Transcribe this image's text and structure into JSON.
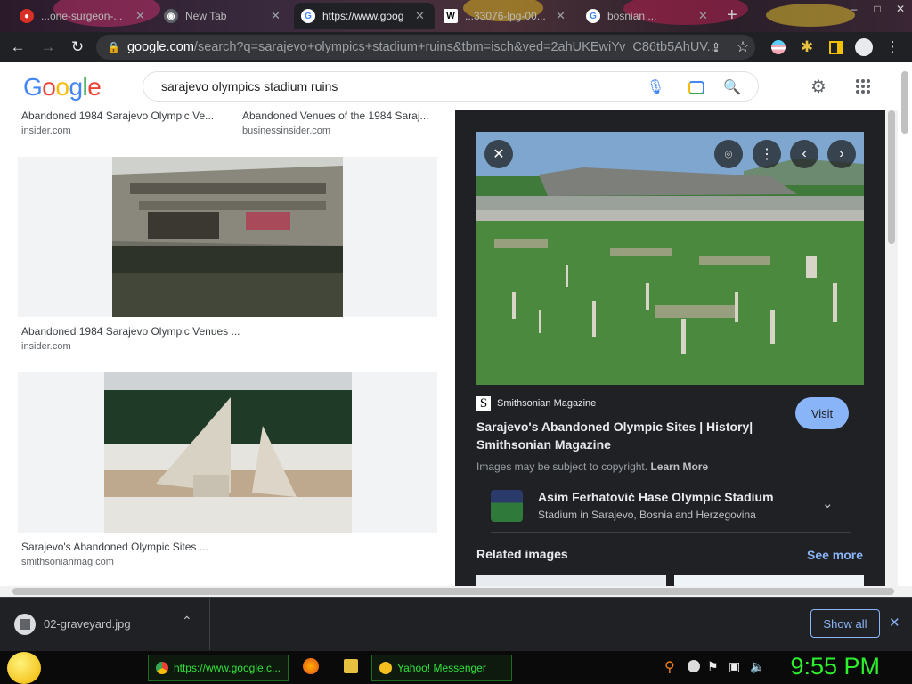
{
  "browser": {
    "tabs": [
      {
        "title": "...one-surgeon-...",
        "favicon": "chrome",
        "active": false
      },
      {
        "title": "New Tab",
        "favicon": "chrome",
        "active": false
      },
      {
        "title": "https://www.goog",
        "favicon": "google",
        "active": true
      },
      {
        "title": "...33076-lpg-00...",
        "favicon": "W",
        "active": false
      },
      {
        "title": "bosnian ...",
        "favicon": "google",
        "active": false
      }
    ],
    "new_tab": "+",
    "window_controls": {
      "minimize": "–",
      "maximize": "□",
      "close": "✕"
    },
    "url_host": "google.com",
    "url_path": "/search?q=sarajevo+olympics+stadium+ruins&tbm=isch&ved=2ahUKEwiYv_C86tb5AhUV..."
  },
  "google": {
    "logo": [
      "G",
      "o",
      "o",
      "g",
      "l",
      "e"
    ],
    "logo_colors": [
      "#4285f4",
      "#ea4335",
      "#fbbc05",
      "#4285f4",
      "#34a853",
      "#ea4335"
    ],
    "search_query": "sarajevo olympics stadium ruins",
    "results": [
      {
        "caption": "Abandoned 1984 Sarajevo Olympic Ve...",
        "site": "insider.com"
      },
      {
        "caption": "Abandoned Venues of the 1984 Saraj...",
        "site": "businessinsider.com"
      },
      {
        "caption": "Abandoned 1984 Sarajevo Olympic Venues ...",
        "site": "insider.com"
      },
      {
        "caption": "Sarajevo's Abandoned Olympic Sites ...",
        "site": "smithsonianmag.com"
      }
    ],
    "preview": {
      "source_initial": "S",
      "source": "Smithsonian Magazine",
      "title_line1": "Sarajevo's Abandoned Olympic Sites | History|",
      "title_line2": "Smithsonian Magazine",
      "visit": "Visit",
      "copyright": "Images may be subject to copyright.",
      "learn_more": "Learn More",
      "entity_name": "Asim Ferhatović Hase Olympic Stadium",
      "entity_desc": "Stadium in Sarajevo, Bosnia and Herzegovina",
      "related_title": "Related images",
      "see_more": "See more"
    }
  },
  "download_bar": {
    "file": "02-graveyard.jpg",
    "show_all": "Show all",
    "close": "✕"
  },
  "taskbar": {
    "chrome_item": "https://www.google.c...",
    "yahoo_item": "Yahoo! Messenger",
    "clock": "9:55 PM"
  },
  "colors": {
    "google_blue": "#1a73e8",
    "link_blue": "#8ab4f8",
    "taskbar_green": "#31e23a"
  }
}
